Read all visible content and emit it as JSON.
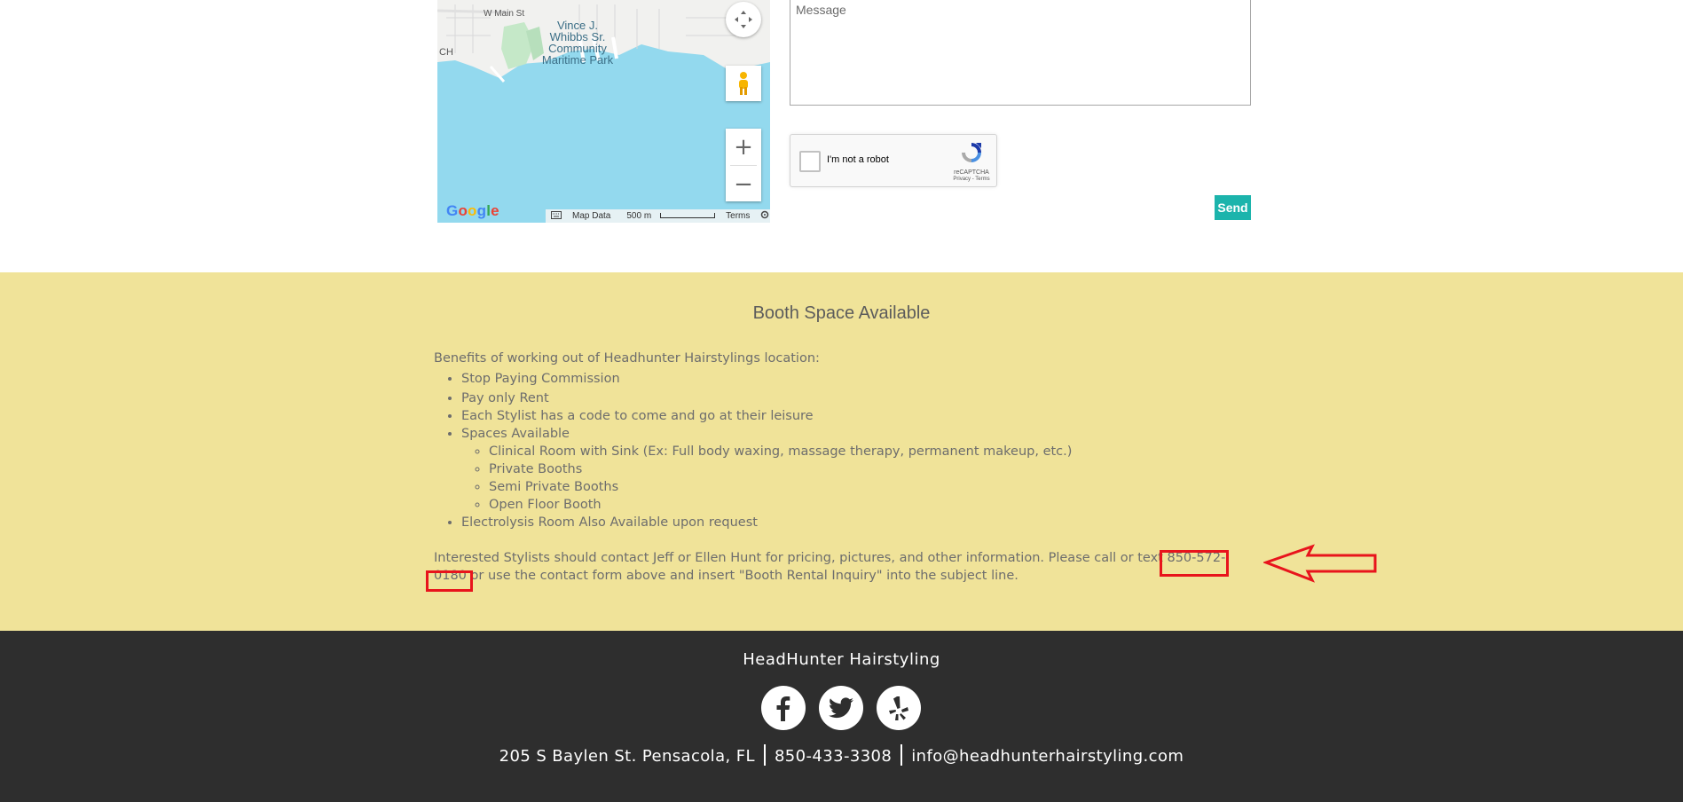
{
  "map": {
    "street_label": "W Main St",
    "park_label": "Vince J. Whibbs Sr. Community Maritime Park",
    "edge_label": "CH",
    "google": "Google",
    "map_data_label": "Map Data",
    "scale_label": "500 m",
    "terms_label": "Terms",
    "water_color": "#93d9ee"
  },
  "form": {
    "message_placeholder": "Message",
    "recaptcha_label": "I'm not a robot",
    "recaptcha_brand": "reCAPTCHA",
    "recaptcha_terms": "Privacy - Terms",
    "send_label": "Send",
    "send_color": "#1cb4ac"
  },
  "booth": {
    "title": "Booth Space Available",
    "intro": "Benefits of working out of Headhunter Hairstylings location:",
    "benefits": [
      "Stop Paying Commission",
      "Pay only Rent",
      "Each Stylist has a code to come and go at their leisure",
      "Spaces Available"
    ],
    "spaces": [
      "Clinical Room with Sink (Ex: Full body waxing, massage therapy, permanent makeup, etc.)",
      "Private Booths",
      "Semi Private Booths",
      "Open Floor Booth"
    ],
    "extra": "Electrolysis Room Also Available upon request",
    "contact_before": "Interested Stylists should contact Jeff or Ellen Hunt for pricing, pictures, and other information. Please call or text ",
    "contact_phone": "850-572-0180",
    "contact_after": " or use the contact form above and insert \"Booth Rental Inquiry\" into the subject line.",
    "background": "#f0e399",
    "highlight_color": "#e8141c"
  },
  "footer": {
    "title": "HeadHunter Hairstyling",
    "address": "205 S Baylen St. Pensacola, FL",
    "phone": "850-433-3308",
    "email": "info@headhunterhairstyling.com",
    "socials": [
      "facebook-icon",
      "twitter-icon",
      "yelp-icon"
    ],
    "background": "#2e2e2e"
  }
}
